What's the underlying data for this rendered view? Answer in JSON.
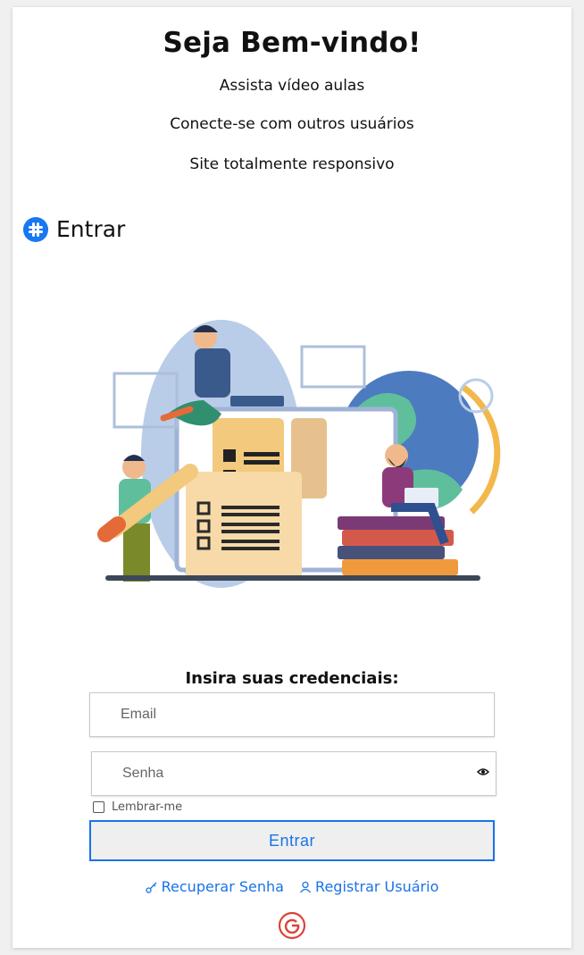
{
  "welcome": {
    "title": "Seja Bem-vindo!",
    "features": [
      "Assista vídeo aulas",
      "Conecte-se com outros usuários",
      "Site totalmente responsivo"
    ]
  },
  "login_header": {
    "icon": "slack-hash-icon",
    "title": "Entrar"
  },
  "illustration": {
    "icon": "education-illustration"
  },
  "form": {
    "heading": "Insira suas credenciais:",
    "email_placeholder": "Email",
    "password_placeholder": "Senha",
    "remember_label": "Lembrar-me",
    "remember_checked": false,
    "submit_label": "Entrar"
  },
  "links": {
    "recover_label": "Recuperar Senha",
    "recover_icon": "key-icon",
    "register_label": "Registrar Usuário",
    "register_icon": "user-icon"
  },
  "footer": {
    "logo": "google-icon"
  },
  "colors": {
    "accent": "#1a73e8",
    "icon_blue": "#1877f2",
    "google_red": "#db4437"
  }
}
